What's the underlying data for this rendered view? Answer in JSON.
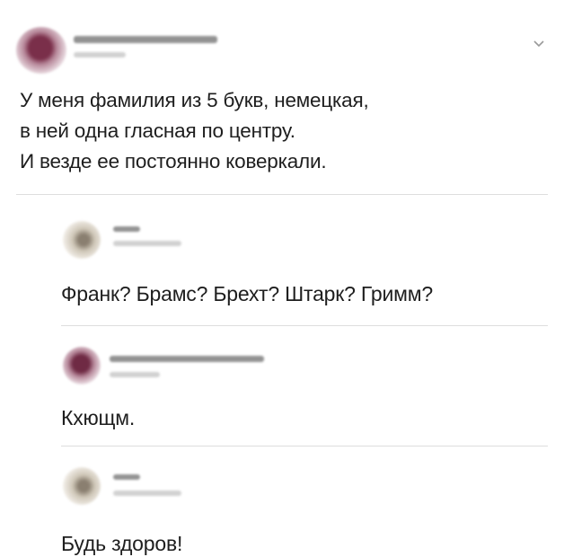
{
  "tweet": {
    "author_name": "",
    "author_handle": "",
    "lines": [
      "У меня фамилия из 5 букв, немецкая,",
      "в ней одна гласная по центру.",
      "И везде ее постоянно коверкали."
    ],
    "menu_icon": "chevron-down-icon"
  },
  "replies": [
    {
      "avatar": "pale",
      "text": "Франк? Брамс? Брехт? Штарк? Гримм?"
    },
    {
      "avatar": "pink",
      "text": "Кхющм."
    },
    {
      "avatar": "pale",
      "text": "Будь здоров!"
    }
  ]
}
